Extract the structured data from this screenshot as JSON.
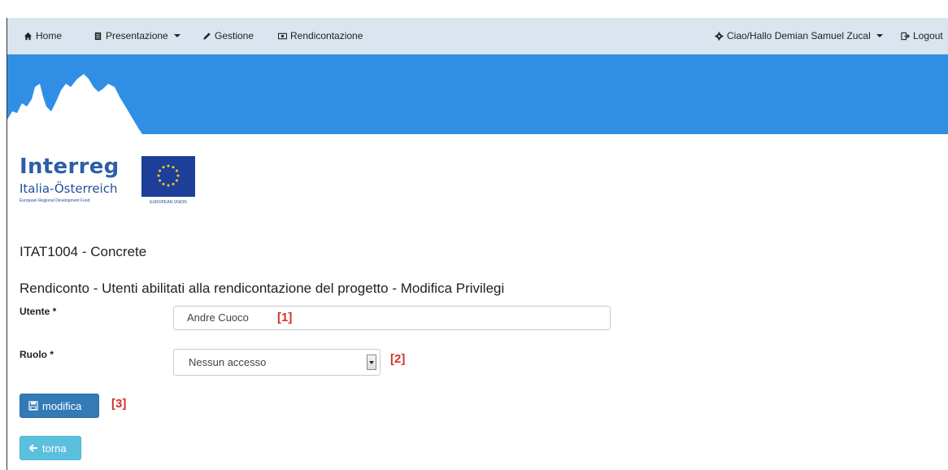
{
  "nav": {
    "home": "Home",
    "presentazione": "Presentazione",
    "gestione": "Gestione",
    "rendicontazione": "Rendicontazione",
    "user_menu": "Ciao/Hallo Demian Samuel Zucal",
    "logout": "Logout"
  },
  "logo": {
    "word": "Interreg",
    "sub": "Italia-Österreich",
    "tagline": "European Regional Development Fund",
    "eu_label": "EUROPEAN UNION"
  },
  "project_title": "ITAT1004 - Concrete",
  "section_title": "Rendiconto - Utenti abilitati alla rendicontazione del progetto - Modifica Privilegi",
  "form": {
    "utente_label": "Utente *",
    "utente_value": "Andre Cuoco",
    "ruolo_label": "Ruolo *",
    "ruolo_value": "Nessun accesso"
  },
  "annotations": [
    "[1]",
    "[2]",
    "[3]"
  ],
  "buttons": {
    "modifica": "modifica",
    "torna": "torna"
  },
  "colors": {
    "navbar": "#dbe5ef",
    "banner": "#308fe5",
    "primary": "#337ab7",
    "info": "#5bc0de",
    "annotation": "#d0312d"
  }
}
